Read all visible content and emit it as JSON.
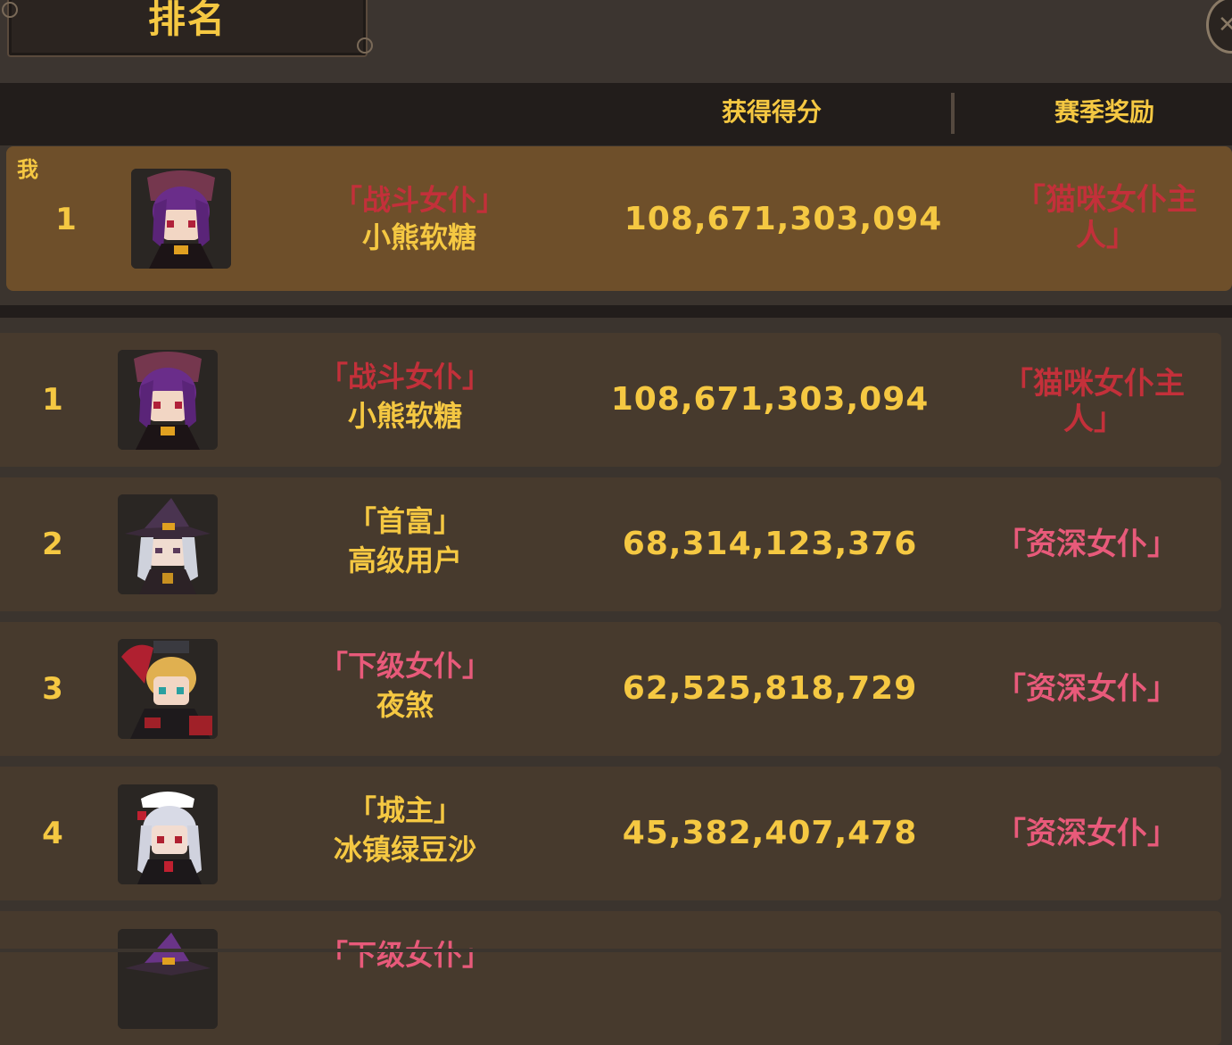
{
  "window": {
    "title": "排名",
    "close_icon": "close-icon"
  },
  "header": {
    "score_label": "获得得分",
    "reward_label": "赛季奖励"
  },
  "colors": {
    "accent": "#f5c842",
    "title_red": "#c3303a",
    "title_pink": "#e85a7a",
    "my_row_bg": "#6e4f2a",
    "row_bg": "#473a2d"
  },
  "my_entry": {
    "tag": "我",
    "rank": "1",
    "title": "「战斗女仆」",
    "name": "小熊软糖",
    "score": "108,671,303,094",
    "reward": "「猫咪女仆主人」",
    "avatar_icon": "purple-hair-maid-avatar-icon"
  },
  "rows": [
    {
      "rank": "1",
      "title": "「战斗女仆」",
      "title_color": "red",
      "name": "小熊软糖",
      "score": "108,671,303,094",
      "reward": "「猫咪女仆主人」",
      "reward_color": "red",
      "avatar_icon": "purple-hair-maid-avatar-icon"
    },
    {
      "rank": "2",
      "title": "「首富」",
      "title_color": "gold",
      "name": "高级用户",
      "score": "68,314,123,376",
      "reward": "「资深女仆」",
      "reward_color": "pink",
      "avatar_icon": "witch-hat-avatar-icon"
    },
    {
      "rank": "3",
      "title": "「下级女仆」",
      "title_color": "pink",
      "name": "夜煞",
      "score": "62,525,818,729",
      "reward": "「资深女仆」",
      "reward_color": "pink",
      "avatar_icon": "blonde-knight-avatar-icon"
    },
    {
      "rank": "4",
      "title": "「城主」",
      "title_color": "gold",
      "name": "冰镇绿豆沙",
      "score": "45,382,407,478",
      "reward": "「资深女仆」",
      "reward_color": "pink",
      "avatar_icon": "silver-hair-maid-avatar-icon"
    },
    {
      "rank": "",
      "title": "「下级女仆」",
      "title_color": "pink",
      "name": "",
      "score": "",
      "reward": "",
      "reward_color": "pink",
      "avatar_icon": "witch-hat-avatar-icon"
    }
  ]
}
